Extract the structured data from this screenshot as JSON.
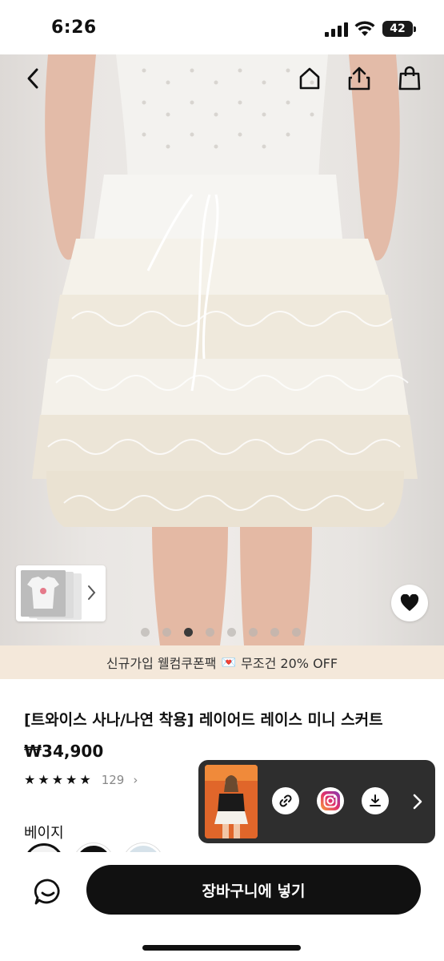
{
  "status_bar": {
    "time": "6:26",
    "battery": "42"
  },
  "nav": {
    "back_icon": "chevron-left-icon",
    "home_icon": "home-icon",
    "share_icon": "share-icon",
    "bag_icon": "shopping-bag-icon"
  },
  "gallery": {
    "dot_count": 8,
    "active_index": 2
  },
  "promo": {
    "text": "신규가입 웰컴쿠폰팩",
    "emoji": "💌",
    "highlight": "무조건 20% OFF"
  },
  "product": {
    "title": "[트와이스 사나/나연 착용] 레이어드 레이스 미니 스커트",
    "price": "₩34,900",
    "rating_stars": 5,
    "review_count": "129"
  },
  "options": {
    "color_label": "베이지",
    "swatches": [
      "#f2f2f2",
      "#111111",
      "#d6e2ea"
    ]
  },
  "bottom": {
    "cart_label": "장바구니에 넣기"
  },
  "colors": {
    "accent": "#111111",
    "promo_bg": "#f4e8da",
    "video_panel": "#2e2e2e"
  }
}
